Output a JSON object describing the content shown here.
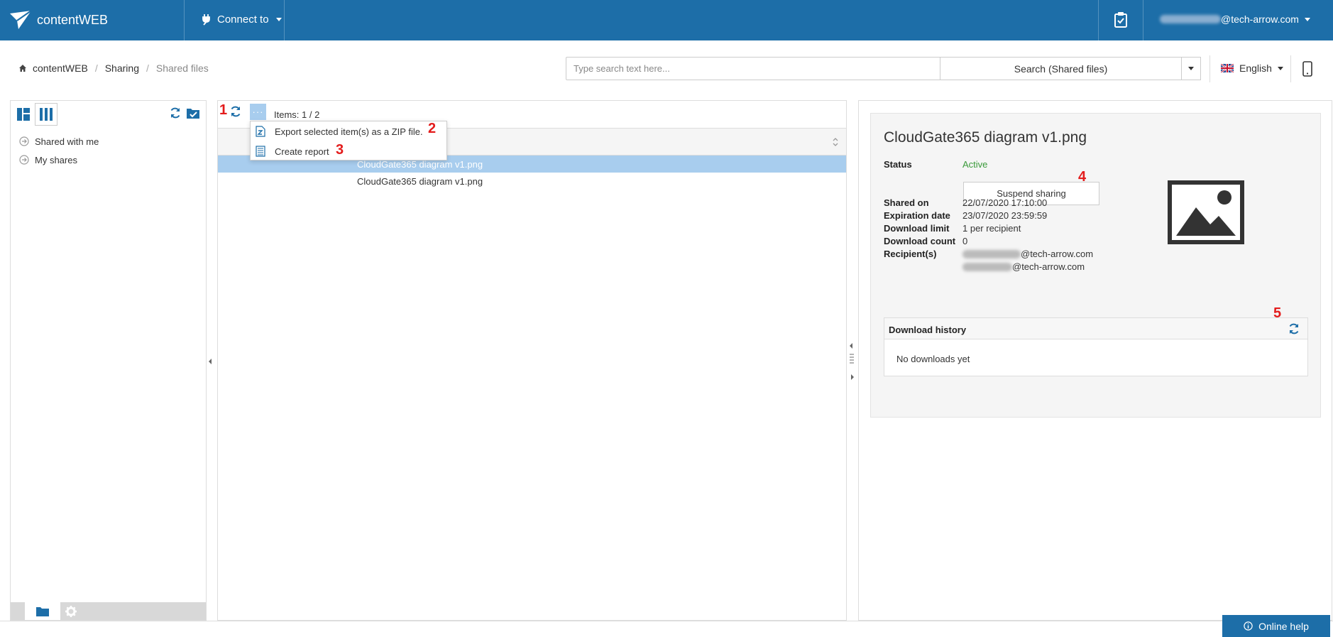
{
  "header": {
    "brand": "contentWEB",
    "connect_label": "Connect to",
    "user_email_suffix": "@tech-arrow.com"
  },
  "breadcrumb": [
    "contentWEB",
    "Sharing",
    "Shared files"
  ],
  "search": {
    "placeholder": "Type search text here...",
    "button_label": "Search (Shared files)"
  },
  "language": "English",
  "left_panel": {
    "tree": [
      "Shared with me",
      "My shares"
    ]
  },
  "middle_panel": {
    "items_count": "Items: 1 / 2",
    "menu": {
      "export_label": "Export selected item(s) as a ZIP file.",
      "report_label": "Create report"
    },
    "rows": [
      "CloudGate365 diagram v1.png",
      "CloudGate365 diagram v1.png"
    ]
  },
  "detail": {
    "title": "CloudGate365 diagram v1.png",
    "labels": {
      "status": "Status",
      "shared_on": "Shared on",
      "expiration": "Expiration date",
      "download_limit": "Download limit",
      "download_count": "Download count",
      "recipients": "Recipient(s)"
    },
    "values": {
      "status": "Active",
      "shared_on": "22/07/2020 17:10:00",
      "expiration": "23/07/2020 23:59:59",
      "download_limit": "1 per recipient",
      "download_count": "0",
      "recipient_suffix": "@tech-arrow.com"
    },
    "suspend_label": "Suspend sharing",
    "history_title": "Download history",
    "history_empty": "No downloads yet"
  },
  "callouts": [
    "1",
    "2",
    "3",
    "4",
    "5"
  ],
  "online_help": "Online help",
  "colors": {
    "brand": "#1d6ea8",
    "selection": "#a8cdee",
    "status_active": "#3a9a3a",
    "callout": "#e31c1c"
  }
}
